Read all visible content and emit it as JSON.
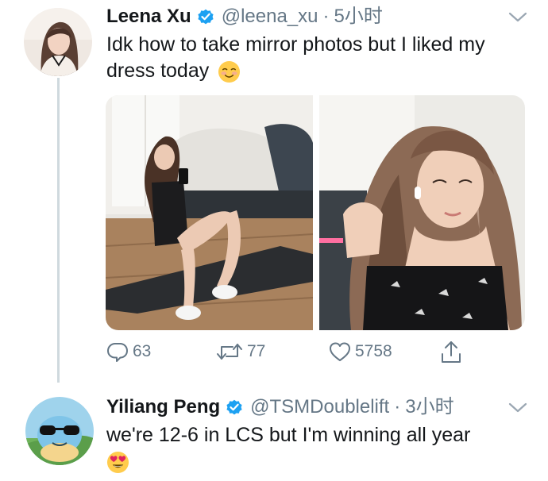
{
  "tweet": {
    "author_name": "Leena Xu",
    "handle": "@leena_xu",
    "separator": "·",
    "time": "5小时",
    "text_line1": "Idk how to take mirror photos but I liked my",
    "text_line2": "dress today",
    "emoji": "smiling-face-emoji",
    "verified": true,
    "media": [
      {
        "name": "mirror-photo-living-room"
      },
      {
        "name": "selfie-photo-butterfly-top"
      }
    ],
    "actions": {
      "reply_count": "63",
      "retweet_count": "77",
      "like_count": "5758"
    }
  },
  "reply": {
    "author_name": "Yiliang Peng",
    "handle": "@TSMDoublelift",
    "separator": "·",
    "time": "3小时",
    "text_line1": "we're 12-6 in LCS but I'm winning all year",
    "emoji": "heart-eyes-emoji",
    "verified": true
  },
  "colors": {
    "text_primary": "#14171a",
    "text_secondary": "#657786",
    "verified_blue": "#1da1f2",
    "thread_line": "#cfd9de",
    "background": "#ffffff"
  }
}
